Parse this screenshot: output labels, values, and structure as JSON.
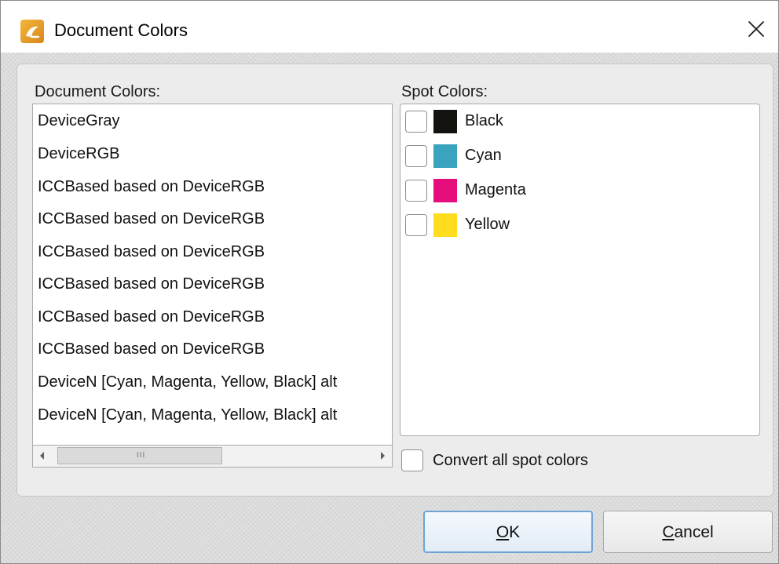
{
  "window": {
    "title": "Document Colors",
    "icon": "app-logo-icon",
    "close_icon": "close-icon"
  },
  "document_colors": {
    "label": "Document Colors:",
    "items": [
      "DeviceGray",
      "DeviceRGB",
      "ICCBased based on DeviceRGB",
      "ICCBased based on DeviceRGB",
      "ICCBased based on DeviceRGB",
      "ICCBased based on DeviceRGB",
      "ICCBased based on DeviceRGB",
      "ICCBased based on DeviceRGB",
      "DeviceN [Cyan, Magenta, Yellow, Black] alt",
      "DeviceN [Cyan, Magenta, Yellow, Black] alt"
    ],
    "scrollbar": {
      "left_icon": "scroll-left-arrow-icon",
      "right_icon": "scroll-right-arrow-icon",
      "grip": "III"
    }
  },
  "spot_colors": {
    "label": "Spot Colors:",
    "items": [
      {
        "name": "Black",
        "color": "#151310",
        "checked": false
      },
      {
        "name": "Cyan",
        "color": "#3aa3bd",
        "checked": false
      },
      {
        "name": "Magenta",
        "color": "#e40d7b",
        "checked": false
      },
      {
        "name": "Yellow",
        "color": "#ffdc1e",
        "checked": false
      }
    ]
  },
  "convert_all": {
    "label": "Convert all spot colors",
    "checked": false
  },
  "buttons": {
    "ok": {
      "mnemonic": "O",
      "rest": "K"
    },
    "cancel": {
      "mnemonic": "C",
      "rest": "ancel"
    }
  },
  "colors": {
    "accent_border": "#6ea4d4",
    "dialog_background": "#dcdcdc",
    "panel_background": "#ececec"
  }
}
